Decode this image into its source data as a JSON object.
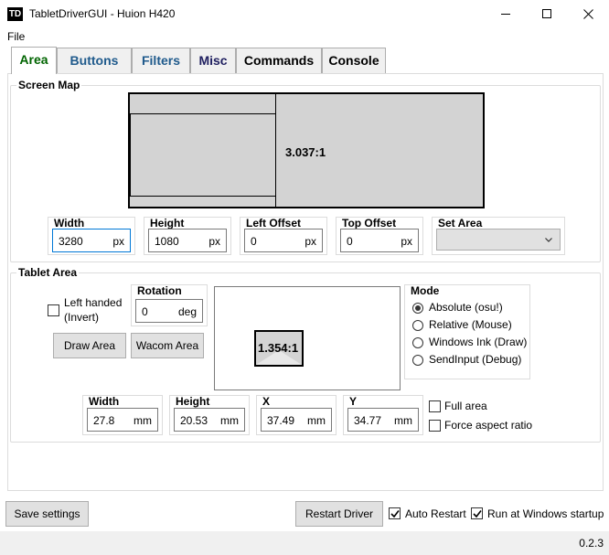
{
  "window": {
    "icon_text": "TD",
    "title": "TabletDriverGUI - Huion H420"
  },
  "menu": {
    "file": "File"
  },
  "tabs": [
    "Area",
    "Buttons",
    "Filters",
    "Misc",
    "Commands",
    "Console"
  ],
  "colors": {
    "tab_area": "#006400",
    "tab_buttons": "#1f5a8c",
    "tab_filters": "#1f5a8c",
    "tab_misc": "#202060",
    "tab_commands": "#000000",
    "tab_console": "#000000",
    "accent": "#0078d7",
    "map_fill": "#d3d3d3"
  },
  "screen_map": {
    "title": "Screen Map",
    "ratio": "3.037:1",
    "width": {
      "label": "Width",
      "value": "3280",
      "unit": "px"
    },
    "height": {
      "label": "Height",
      "value": "1080",
      "unit": "px"
    },
    "left_offset": {
      "label": "Left Offset",
      "value": "0",
      "unit": "px"
    },
    "top_offset": {
      "label": "Top Offset",
      "value": "0",
      "unit": "px"
    },
    "set_area": {
      "label": "Set Area",
      "value": ""
    }
  },
  "tablet_area": {
    "title": "Tablet Area",
    "left_handed": {
      "label_line1": "Left handed",
      "label_line2": "(Invert)",
      "checked": false
    },
    "rotation": {
      "label": "Rotation",
      "value": "0",
      "unit": "deg"
    },
    "draw_area_button": "Draw Area",
    "wacom_area_button": "Wacom Area",
    "ratio": "1.354:1",
    "mode": {
      "title": "Mode",
      "options": [
        "Absolute (osu!)",
        "Relative (Mouse)",
        "Windows Ink (Draw)",
        "SendInput (Debug)"
      ],
      "selected": "Absolute (osu!)"
    },
    "width": {
      "label": "Width",
      "value": "27.8",
      "unit": "mm"
    },
    "height": {
      "label": "Height",
      "value": "20.53",
      "unit": "mm"
    },
    "x": {
      "label": "X",
      "value": "37.49",
      "unit": "mm"
    },
    "y": {
      "label": "Y",
      "value": "34.77",
      "unit": "mm"
    },
    "full_area": {
      "label": "Full area",
      "checked": false
    },
    "force_aspect": {
      "label": "Force aspect ratio",
      "checked": false
    }
  },
  "bottom": {
    "save_button": "Save settings",
    "restart_button": "Restart Driver",
    "auto_restart": {
      "label": "Auto Restart",
      "checked": true
    },
    "run_at_startup": {
      "label": "Run at Windows startup",
      "checked": true
    }
  },
  "status": {
    "version": "0.2.3"
  },
  "icons": [
    "minimize-icon",
    "maximize-icon",
    "close-icon",
    "chevron-down-icon",
    "checkmark-icon"
  ]
}
